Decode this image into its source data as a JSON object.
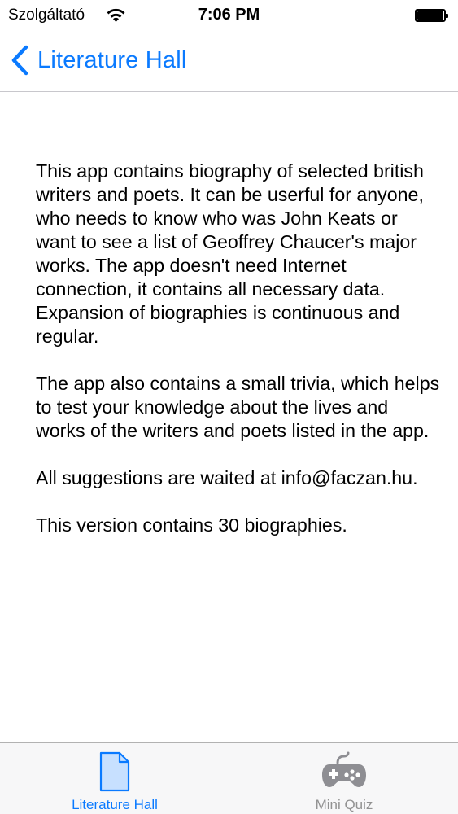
{
  "status_bar": {
    "carrier": "Szolgáltató",
    "time": "7:06 PM",
    "wifi_icon": "wifi-icon",
    "battery_icon": "battery-icon"
  },
  "nav_bar": {
    "back_label": "Literature Hall",
    "back_icon": "chevron-left-icon"
  },
  "content": {
    "paragraphs": [
      "This app contains biography of selected british writers and poets. It can be userful for anyone, who needs to know who was John Keats or want to see a list of Geoffrey Chaucer's major works. The app doesn't need Internet connection, it contains all necessary data. Expansion of biographies is continuous and regular.",
      "The app also contains a small trivia, which helps to test your knowledge about the lives and works of the writers and poets listed in the app.",
      "All suggestions are waited at info@faczan.hu.",
      "This version contains 30 biographies."
    ]
  },
  "tab_bar": {
    "tabs": [
      {
        "label": "Literature Hall",
        "icon": "document-icon",
        "selected": true
      },
      {
        "label": "Mini Quiz",
        "icon": "gamepad-icon",
        "selected": false
      }
    ]
  },
  "colors": {
    "accent": "#0a7aff",
    "inactive": "#929292",
    "tab_bar_bg": "#f7f7f8"
  }
}
